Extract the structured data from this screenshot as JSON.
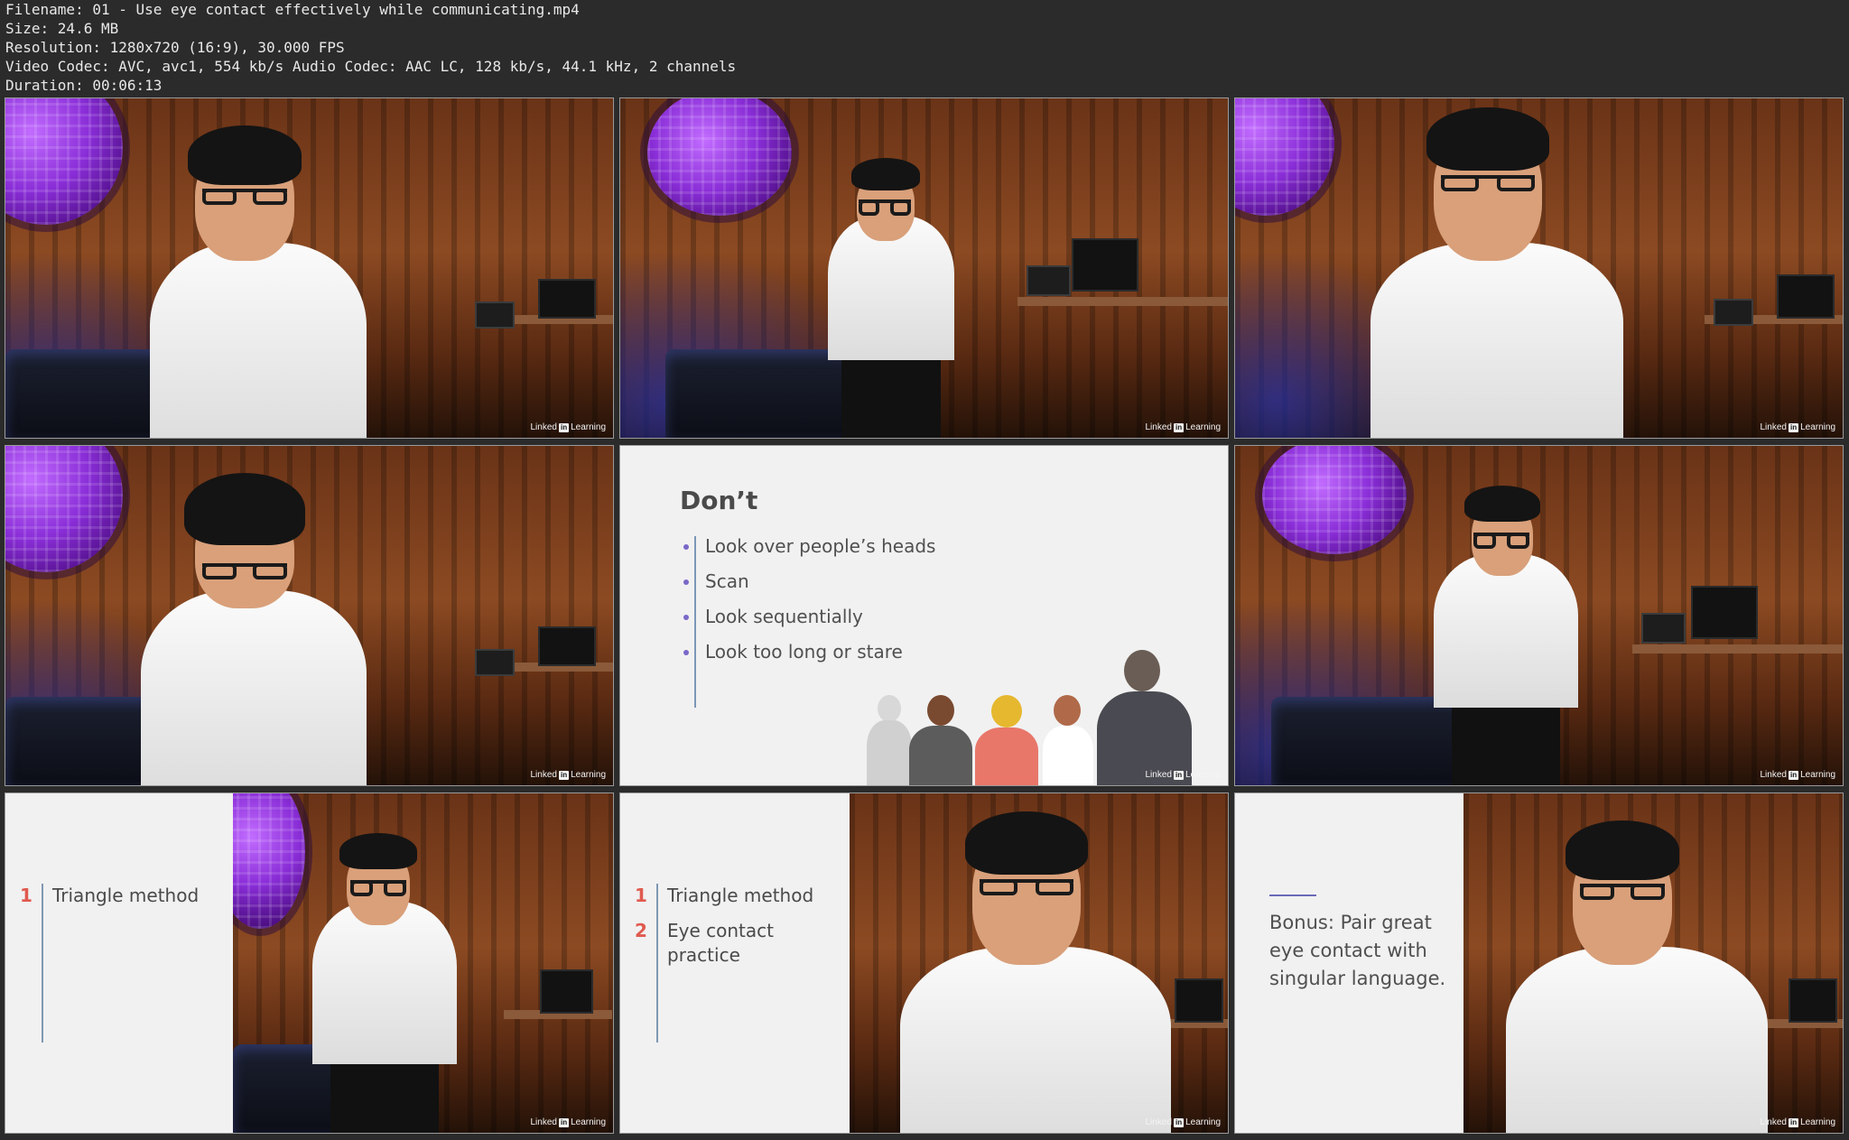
{
  "header": {
    "filename": "Filename: 01 - Use eye contact effectively while communicating.mp4",
    "size": "Size: 24.6 MB",
    "resolution": "Resolution: 1280x720 (16:9), 30.000 FPS",
    "codecs": "Video Codec: AVC, avc1, 554 kb/s Audio Codec: AAC LC, 128 kb/s, 44.1 kHz, 2 channels",
    "duration": "Duration: 00:06:13"
  },
  "watermark": {
    "brand": "Linked",
    "brand_box": "in",
    "brand_suffix": "Learning"
  },
  "slide_dont": {
    "title": "Don’t",
    "bullets": [
      "Look over people’s heads",
      "Scan",
      "Look sequentially",
      "Look too long or stare"
    ]
  },
  "slide_triangle": {
    "items": [
      {
        "num": "1",
        "label": "Triangle method"
      }
    ]
  },
  "slide_practice": {
    "items": [
      {
        "num": "1",
        "label": "Triangle method"
      },
      {
        "num": "2",
        "label": "Eye contact practice"
      }
    ]
  },
  "slide_bonus": {
    "text": "Bonus: Pair great eye contact with singular language."
  },
  "colors": {
    "accent_number": "#e05a4f",
    "rule": "#7f98b3",
    "bullet_dot": "#7a68c8"
  }
}
